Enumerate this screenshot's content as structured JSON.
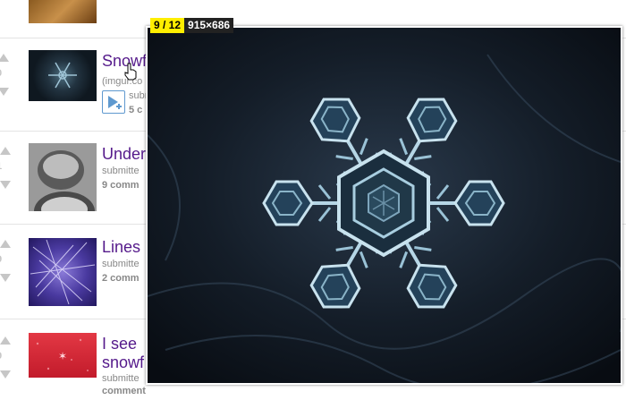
{
  "posts": [
    {
      "score": "",
      "title": "",
      "meta": "",
      "comments": ""
    },
    {
      "score": "0",
      "title": "Snowf",
      "meta": "(imgur.co",
      "meta2": "subm",
      "comments": "5 c"
    },
    {
      "score": "1",
      "title": "Under",
      "meta": "submitte",
      "comments": "9 comm"
    },
    {
      "score": "9",
      "title": "Lines",
      "meta": "submitte",
      "comments": "2 comm"
    },
    {
      "score": "9",
      "title": "I see",
      "title2": "snowf",
      "meta": "submitte",
      "comments": "comment"
    }
  ],
  "viewer": {
    "counter": "9 / 12",
    "dimensions": "915×686"
  }
}
